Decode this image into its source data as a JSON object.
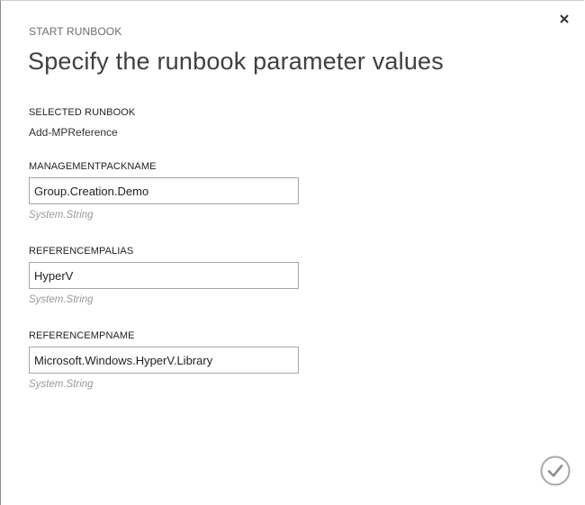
{
  "dialog": {
    "section_label": "START RUNBOOK",
    "title": "Specify the runbook parameter values"
  },
  "selected_runbook": {
    "label": "SELECTED RUNBOOK",
    "value": "Add-MPReference"
  },
  "fields": [
    {
      "label": "MANAGEMENTPACKNAME",
      "value": "Group.Creation.Demo",
      "type_hint": "System.String"
    },
    {
      "label": "REFERENCEMPALIAS",
      "value": "HyperV",
      "type_hint": "System.String"
    },
    {
      "label": "REFERENCEMPNAME",
      "value": "Microsoft.Windows.HyperV.Library",
      "type_hint": "System.String"
    }
  ],
  "icons": {
    "close": "close-icon",
    "confirm": "checkmark-circle-icon"
  },
  "colors": {
    "border": "#a6a6a6",
    "hint": "#9a9a9a",
    "title": "#404040"
  }
}
